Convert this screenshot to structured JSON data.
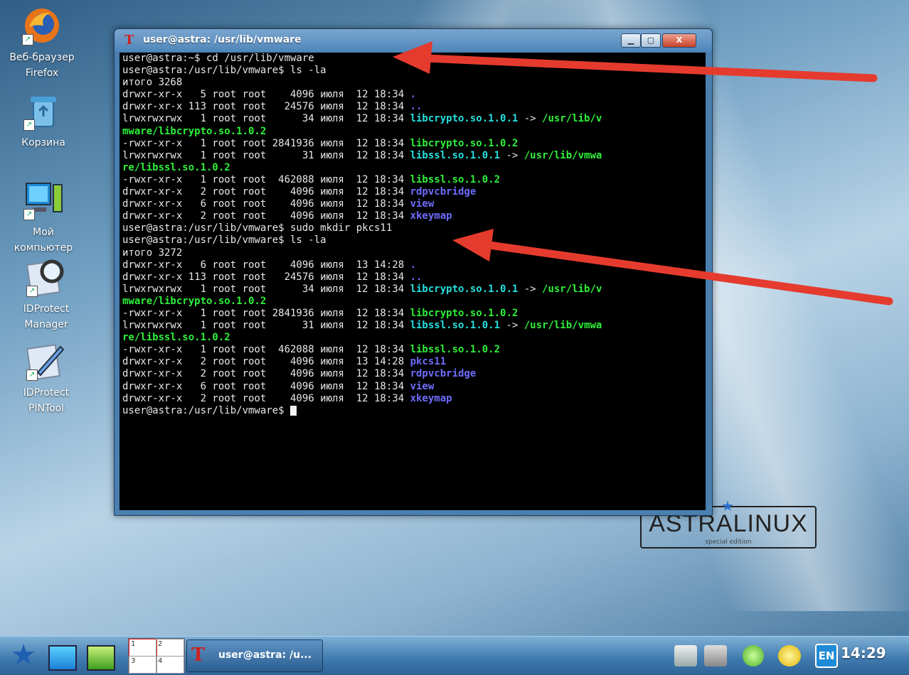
{
  "desktop": {
    "icons": [
      {
        "label_line1": "Веб-браузер",
        "label_line2": "Firefox",
        "icon": "firefox-icon"
      },
      {
        "label_line1": "Корзина",
        "label_line2": "",
        "icon": "trash-icon"
      },
      {
        "label_line1": "Мой",
        "label_line2": "компьютер",
        "icon": "computer-icon"
      },
      {
        "label_line1": "IDProtect",
        "label_line2": "Manager",
        "icon": "magnifier-icon"
      },
      {
        "label_line1": "IDProtect",
        "label_line2": "PINTool",
        "icon": "pen-icon"
      }
    ]
  },
  "window": {
    "title": "user@astra: /usr/lib/vmware",
    "buttons": {
      "minimize": "▁",
      "maximize": "▢",
      "close": "X"
    }
  },
  "terminal": {
    "colors": {
      "text": "#e8e8e8",
      "cyan": "#27e0e0",
      "green": "#2ef03a",
      "blue": "#6d6dff"
    },
    "lines": [
      [
        {
          "t": "user@astra:~$ cd /usr/lib/vmware",
          "c": "white"
        }
      ],
      [
        {
          "t": "user@astra:/usr/lib/vmware$ ls -la",
          "c": "white"
        }
      ],
      [
        {
          "t": "итого 3268",
          "c": "white"
        }
      ],
      [
        {
          "t": "drwxr-xr-x   5 root root    4096 июля  12 18:34 ",
          "c": "white"
        },
        {
          "t": ".",
          "c": "blue"
        }
      ],
      [
        {
          "t": "drwxr-xr-x 113 root root   24576 июля  12 18:34 ",
          "c": "white"
        },
        {
          "t": "..",
          "c": "blue"
        }
      ],
      [
        {
          "t": "lrwxrwxrwx   1 root root      34 июля  12 18:34 ",
          "c": "white"
        },
        {
          "t": "libcrypto.so.1.0.1",
          "c": "cyan"
        },
        {
          "t": " -> ",
          "c": "white"
        },
        {
          "t": "/usr/lib/v",
          "c": "green"
        }
      ],
      [
        {
          "t": "mware/libcrypto.so.1.0.2",
          "c": "green"
        }
      ],
      [
        {
          "t": "-rwxr-xr-x   1 root root 2841936 июля  12 18:34 ",
          "c": "white"
        },
        {
          "t": "libcrypto.so.1.0.2",
          "c": "green"
        }
      ],
      [
        {
          "t": "lrwxrwxrwx   1 root root      31 июля  12 18:34 ",
          "c": "white"
        },
        {
          "t": "libssl.so.1.0.1",
          "c": "cyan"
        },
        {
          "t": " -> ",
          "c": "white"
        },
        {
          "t": "/usr/lib/vmwa",
          "c": "green"
        }
      ],
      [
        {
          "t": "re/libssl.so.1.0.2",
          "c": "green"
        }
      ],
      [
        {
          "t": "-rwxr-xr-x   1 root root  462088 июля  12 18:34 ",
          "c": "white"
        },
        {
          "t": "libssl.so.1.0.2",
          "c": "green"
        }
      ],
      [
        {
          "t": "drwxr-xr-x   2 root root    4096 июля  12 18:34 ",
          "c": "white"
        },
        {
          "t": "rdpvcbridge",
          "c": "blue"
        }
      ],
      [
        {
          "t": "drwxr-xr-x   6 root root    4096 июля  12 18:34 ",
          "c": "white"
        },
        {
          "t": "view",
          "c": "blue"
        }
      ],
      [
        {
          "t": "drwxr-xr-x   2 root root    4096 июля  12 18:34 ",
          "c": "white"
        },
        {
          "t": "xkeymap",
          "c": "blue"
        }
      ],
      [
        {
          "t": "user@astra:/usr/lib/vmware$ sudo mkdir pkcs11",
          "c": "white"
        }
      ],
      [
        {
          "t": "user@astra:/usr/lib/vmware$ ls -la",
          "c": "white"
        }
      ],
      [
        {
          "t": "итого 3272",
          "c": "white"
        }
      ],
      [
        {
          "t": "drwxr-xr-x   6 root root    4096 июля  13 14:28 ",
          "c": "white"
        },
        {
          "t": ".",
          "c": "blue"
        }
      ],
      [
        {
          "t": "drwxr-xr-x 113 root root   24576 июля  12 18:34 ",
          "c": "white"
        },
        {
          "t": "..",
          "c": "blue"
        }
      ],
      [
        {
          "t": "lrwxrwxrwx   1 root root      34 июля  12 18:34 ",
          "c": "white"
        },
        {
          "t": "libcrypto.so.1.0.1",
          "c": "cyan"
        },
        {
          "t": " -> ",
          "c": "white"
        },
        {
          "t": "/usr/lib/v",
          "c": "green"
        }
      ],
      [
        {
          "t": "mware/libcrypto.so.1.0.2",
          "c": "green"
        }
      ],
      [
        {
          "t": "-rwxr-xr-x   1 root root 2841936 июля  12 18:34 ",
          "c": "white"
        },
        {
          "t": "libcrypto.so.1.0.2",
          "c": "green"
        }
      ],
      [
        {
          "t": "lrwxrwxrwx   1 root root      31 июля  12 18:34 ",
          "c": "white"
        },
        {
          "t": "libssl.so.1.0.1",
          "c": "cyan"
        },
        {
          "t": " -> ",
          "c": "white"
        },
        {
          "t": "/usr/lib/vmwa",
          "c": "green"
        }
      ],
      [
        {
          "t": "re/libssl.so.1.0.2",
          "c": "green"
        }
      ],
      [
        {
          "t": "-rwxr-xr-x   1 root root  462088 июля  12 18:34 ",
          "c": "white"
        },
        {
          "t": "libssl.so.1.0.2",
          "c": "green"
        }
      ],
      [
        {
          "t": "drwxr-xr-x   2 root root    4096 июля  13 14:28 ",
          "c": "white"
        },
        {
          "t": "pkcs11",
          "c": "blue"
        }
      ],
      [
        {
          "t": "drwxr-xr-x   2 root root    4096 июля  12 18:34 ",
          "c": "white"
        },
        {
          "t": "rdpvcbridge",
          "c": "blue"
        }
      ],
      [
        {
          "t": "drwxr-xr-x   6 root root    4096 июля  12 18:34 ",
          "c": "white"
        },
        {
          "t": "view",
          "c": "blue"
        }
      ],
      [
        {
          "t": "drwxr-xr-x   2 root root    4096 июля  12 18:34 ",
          "c": "white"
        },
        {
          "t": "xkeymap",
          "c": "blue"
        }
      ],
      [
        {
          "t": "user@astra:/usr/lib/vmware$ ",
          "c": "white"
        },
        {
          "t": "",
          "c": "cursor"
        }
      ]
    ]
  },
  "branding": {
    "logo_name": "ASTRALINUX",
    "logo_sub": "special edition"
  },
  "annotation": {
    "arrow_color": "#e53b2e"
  },
  "taskbar": {
    "pager": [
      "1",
      "2",
      "3",
      "4"
    ],
    "task_title": "user@astra: /u...",
    "lang": "EN",
    "clock": "14:29"
  }
}
